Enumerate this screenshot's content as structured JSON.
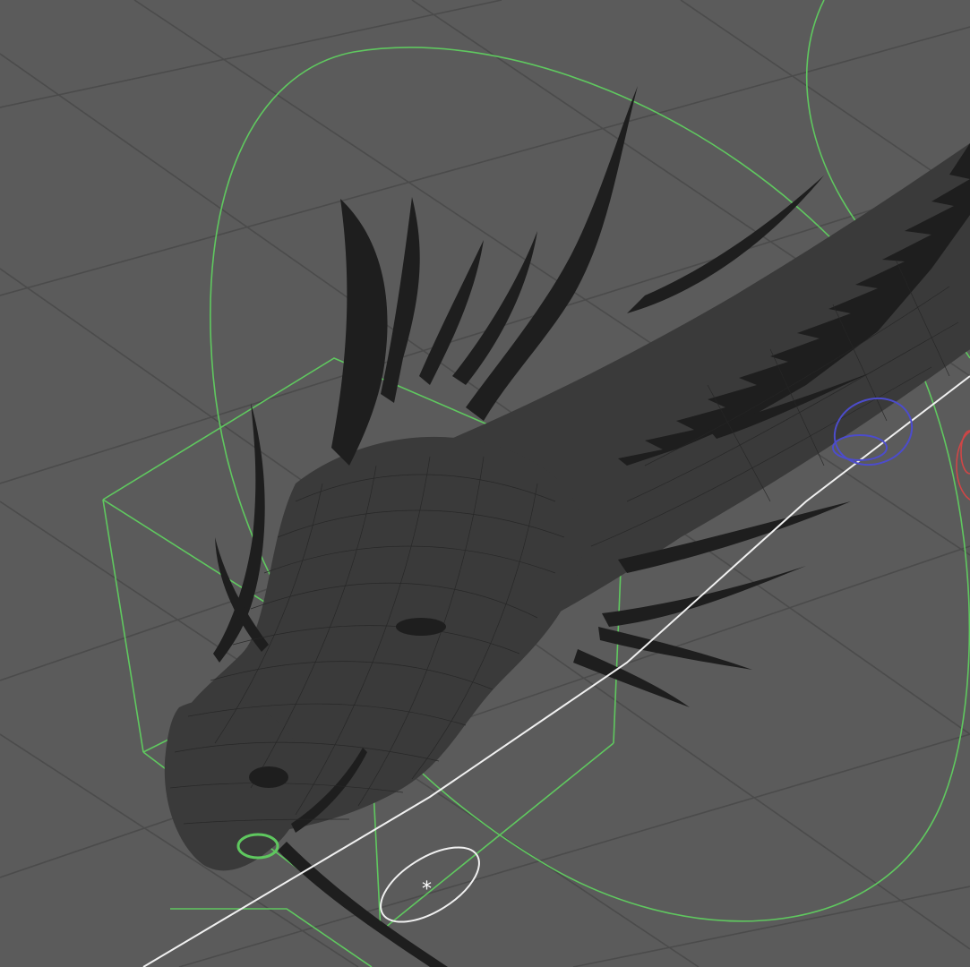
{
  "viewport": {
    "background_color": "#5b5b5b",
    "grid_color": "#4b4b4b",
    "view_mode": "wireframe-on-shaded"
  },
  "model": {
    "subject": "dragon-head-wireframe",
    "mesh_color": "#2a2a2a",
    "wire_color": "#1c1c1c"
  },
  "controls": {
    "head_circle_color": "#5fc85f",
    "head_box_color": "#5fc85f",
    "neck_joint_color": "#4c4ccc",
    "spine_joint_color": "#d04646",
    "jaw_locator_color": "#f0f0f0",
    "jaw_locator_icon": "asterisk-icon"
  }
}
